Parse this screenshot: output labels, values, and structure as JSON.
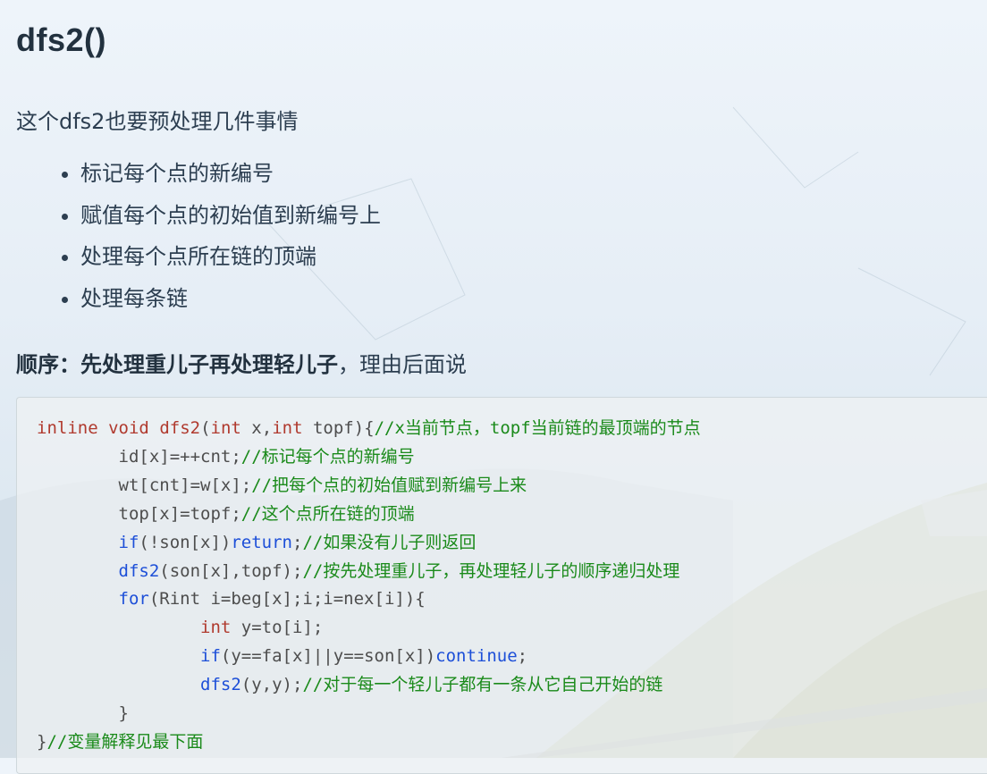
{
  "title": "dfs2()",
  "intro": "这个dfs2也要预处理几件事情",
  "points": [
    "标记每个点的新编号",
    "赋值每个点的初始值到新编号上",
    "处理每个点所在链的顶端",
    "处理每条链"
  ],
  "order": {
    "label": "顺序：",
    "emphasis": "先处理重儿子再处理轻儿子",
    "rest": "，理由后面说"
  },
  "code_lines": [
    "inline void dfs2(int x,int topf){//x当前节点，topf当前链的最顶端的节点",
    "        id[x]=++cnt;//标记每个点的新编号",
    "        wt[cnt]=w[x];//把每个点的初始值赋到新编号上来",
    "        top[x]=topf;//这个点所在链的顶端",
    "        if(!son[x])return;//如果没有儿子则返回",
    "        dfs2(son[x],topf);//按先处理重儿子，再处理轻儿子的顺序递归处理",
    "        for(Rint i=beg[x];i;i=nex[i]){",
    "                int y=to[i];",
    "                if(y==fa[x]||y==son[x])continue;",
    "                dfs2(y,y);//对于每一个轻儿子都有一条从它自己开始的链",
    "        }",
    "}//变量解释见最下面"
  ]
}
